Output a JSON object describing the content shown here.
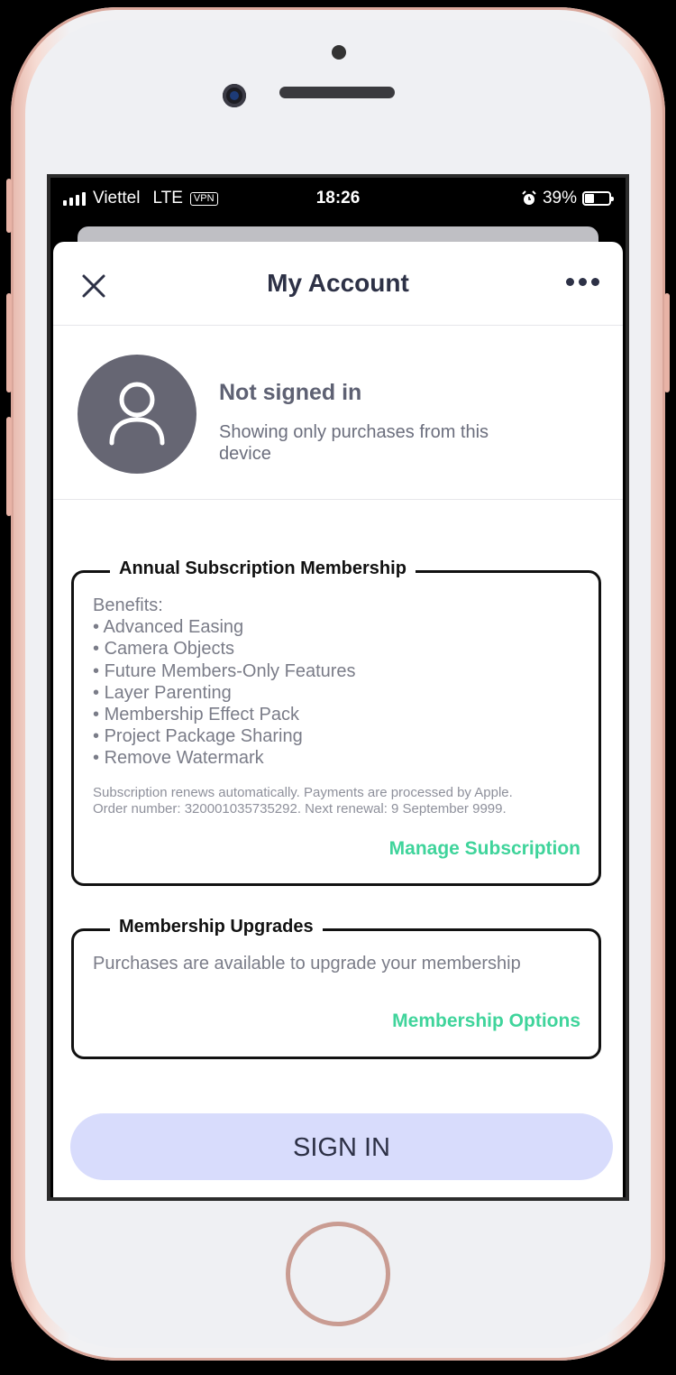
{
  "status_bar": {
    "carrier": "Viettel",
    "network": "LTE",
    "vpn": "VPN",
    "time": "18:26",
    "battery": "39%",
    "icons": [
      "signal-icon",
      "alarm-icon",
      "battery-icon"
    ]
  },
  "header": {
    "title": "My Account",
    "close_icon": "close-icon",
    "more_icon": "more-icon"
  },
  "profile": {
    "status": "Not signed in",
    "subtitle": "Showing only purchases from this device",
    "avatar_icon": "user-icon"
  },
  "subscription": {
    "legend": "Annual Subscription Membership",
    "benefits_heading": "Benefits:",
    "benefits": [
      "Advanced Easing",
      "Camera Objects",
      "Future Members-Only Features",
      "Layer Parenting",
      "Membership Effect Pack",
      "Project Package Sharing",
      "Remove Watermark"
    ],
    "fine_print_line1": "Subscription renews automatically. Payments are processed by Apple.",
    "fine_print_line2": "Order number: 320001035735292. Next renewal: 9 September 9999.",
    "manage_label": "Manage Subscription"
  },
  "upgrades": {
    "legend": "Membership Upgrades",
    "text": "Purchases are available to upgrade your membership",
    "options_label": "Membership Options"
  },
  "sign_in_label": "SIGN IN",
  "colors": {
    "accent_green": "#3fd49b",
    "sign_in_bg": "#d8dcfc",
    "avatar_bg": "#666673",
    "title_text": "#2d3146"
  }
}
